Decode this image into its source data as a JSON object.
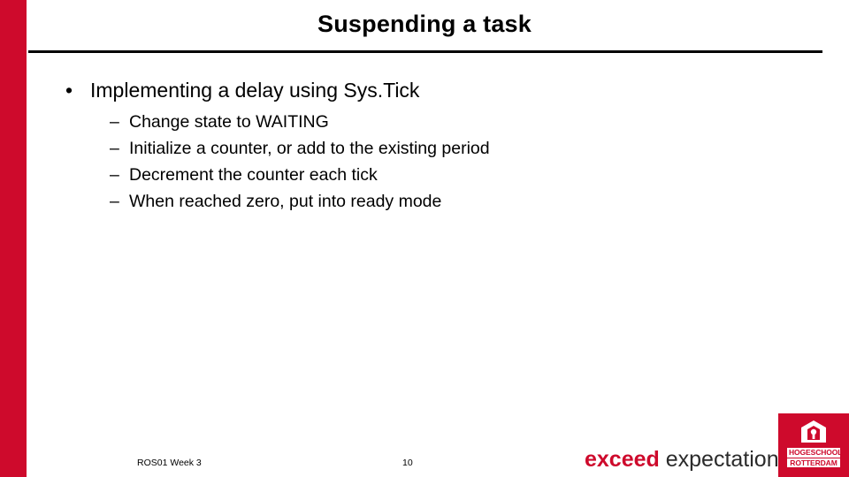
{
  "slide": {
    "title": "Suspending a task",
    "bullets": [
      {
        "level": 1,
        "marker": "•",
        "text": "Implementing a delay using Sys.Tick"
      },
      {
        "level": 2,
        "marker": "–",
        "text": "Change state to WAITING"
      },
      {
        "level": 2,
        "marker": "–",
        "text": "Initialize a counter, or add to the existing period"
      },
      {
        "level": 2,
        "marker": "–",
        "text": "Decrement the counter each tick"
      },
      {
        "level": 2,
        "marker": "–",
        "text": "When reached zero, put into ready mode"
      }
    ],
    "footer": {
      "left": "ROS01 Week 3",
      "page_number": "10"
    },
    "tagline": {
      "word1": "exceed",
      "word2": "expectations"
    },
    "logo": {
      "line1": "HOGESCHOOL",
      "line2": "ROTTERDAM"
    },
    "colors": {
      "accent_red": "#CE0A2C",
      "text_black": "#000000"
    }
  }
}
